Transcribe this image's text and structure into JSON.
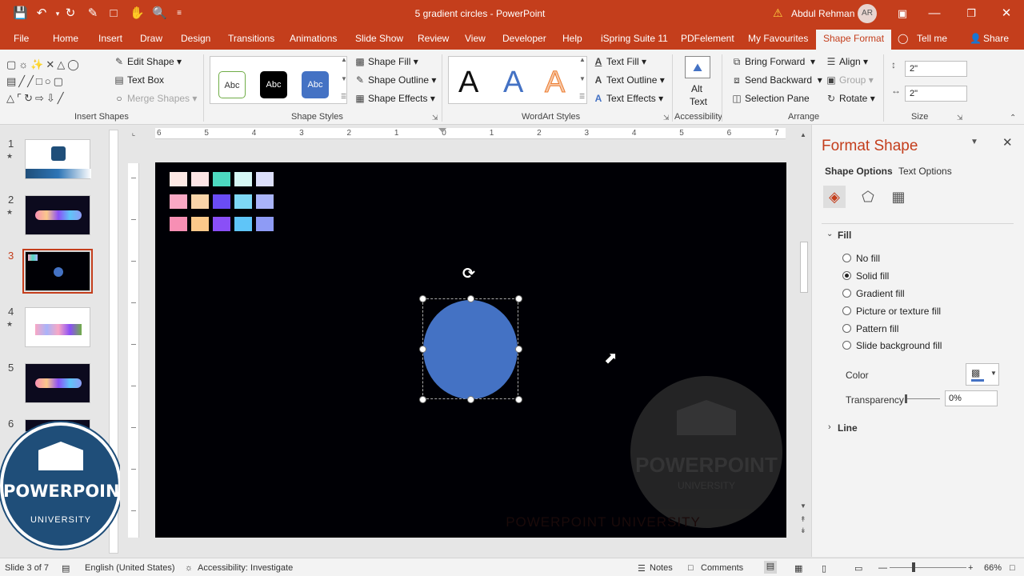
{
  "titlebar": {
    "title": "5 gradient circles  -  PowerPoint",
    "warning_icon": "warning-icon",
    "user_name": "Abdul Rehman",
    "user_initials": "AR"
  },
  "tabs": [
    "File",
    "Home",
    "Insert",
    "Draw",
    "Design",
    "Transitions",
    "Animations",
    "Slide Show",
    "Review",
    "View",
    "Developer",
    "Help",
    "iSpring Suite 11",
    "PDFelement",
    "My Favourites",
    "Shape Format"
  ],
  "tell_me": "Tell me",
  "share": "Share",
  "ribbon": {
    "insert_shapes": {
      "label": "Insert Shapes",
      "edit_shape": "Edit Shape",
      "text_box": "Text Box",
      "merge_shapes": "Merge Shapes"
    },
    "shape_styles": {
      "label": "Shape Styles",
      "swatch_text": "Abc",
      "shape_fill": "Shape Fill",
      "shape_outline": "Shape Outline",
      "shape_effects": "Shape Effects"
    },
    "wordart": {
      "label": "WordArt Styles",
      "letter": "A",
      "text_fill": "Text Fill",
      "text_outline": "Text Outline",
      "text_effects": "Text Effects"
    },
    "accessibility": {
      "label": "Accessibility",
      "alt_text_line1": "Alt",
      "alt_text_line2": "Text"
    },
    "arrange": {
      "label": "Arrange",
      "bring_forward": "Bring Forward",
      "send_backward": "Send Backward",
      "selection_pane": "Selection Pane",
      "align": "Align",
      "group": "Group",
      "rotate": "Rotate"
    },
    "size": {
      "label": "Size",
      "height": "2\"",
      "width": "2\""
    }
  },
  "ruler": {
    "h_ticks": [
      "6",
      "5",
      "4",
      "3",
      "2",
      "1",
      "0",
      "1",
      "2",
      "3",
      "4",
      "5",
      "6",
      "7"
    ]
  },
  "slides": [
    {
      "num": "1",
      "star": true
    },
    {
      "num": "2",
      "star": true
    },
    {
      "num": "3",
      "star": false
    },
    {
      "num": "4",
      "star": true
    },
    {
      "num": "5",
      "star": false
    },
    {
      "num": "6",
      "star": false
    }
  ],
  "palette": {
    "rows": [
      [
        "#fde8e4",
        "#fde4e4",
        "#4dd9c0",
        "#d6f7f5",
        "#dcdffa"
      ],
      [
        "#f9a8c4",
        "#f9d4a8",
        "#6a4cf5",
        "#7ed8f5",
        "#a9b4f9"
      ],
      [
        "#f78fb4",
        "#fbc88a",
        "#8a4ff7",
        "#5fc5f8",
        "#8e9bf5"
      ]
    ]
  },
  "canvas": {
    "circle_color": "#4472c4",
    "watermark_word": "POWERPOINT",
    "watermark_sub": "UNIVERSITY",
    "bottom_text": "POWERPOINT UNIVERSITY"
  },
  "logo": {
    "word": "POWERPOINT",
    "sub": "UNIVERSITY"
  },
  "format_pane": {
    "title": "Format Shape",
    "tab_shape": "Shape Options",
    "tab_text": "Text Options",
    "fill_section": "Fill",
    "options": [
      "No fill",
      "Solid fill",
      "Gradient fill",
      "Picture or texture fill",
      "Pattern fill",
      "Slide background fill"
    ],
    "selected_option": "Solid fill",
    "color_label": "Color",
    "transparency_label": "Transparency",
    "transparency_value": "0%",
    "line_section": "Line"
  },
  "statusbar": {
    "slide_info": "Slide 3 of 7",
    "language": "English (United States)",
    "accessibility": "Accessibility: Investigate",
    "notes": "Notes",
    "comments": "Comments",
    "zoom": "66%"
  },
  "colors": {
    "accent": "#c43e1c",
    "shape_fill": "#4472c4"
  }
}
